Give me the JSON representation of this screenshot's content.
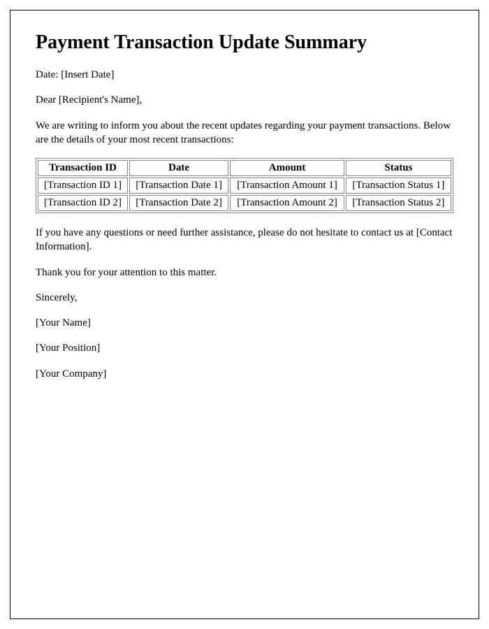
{
  "title": "Payment Transaction Update Summary",
  "date_line": "Date: [Insert Date]",
  "salutation": "Dear [Recipient's Name],",
  "intro": "We are writing to inform you about the recent updates regarding your payment transactions. Below are the details of your most recent transactions:",
  "table": {
    "headers": {
      "id": "Transaction ID",
      "date": "Date",
      "amount": "Amount",
      "status": "Status"
    },
    "rows": [
      {
        "id": "[Transaction ID 1]",
        "date": "[Transaction Date 1]",
        "amount": "[Transaction Amount 1]",
        "status": "[Transaction Status 1]"
      },
      {
        "id": "[Transaction ID 2]",
        "date": "[Transaction Date 2]",
        "amount": "[Transaction Amount 2]",
        "status": "[Transaction Status 2]"
      }
    ]
  },
  "contact": "If you have any questions or need further assistance, please do not hesitate to contact us at [Contact Information].",
  "thanks": "Thank you for your attention to this matter.",
  "closing": "Sincerely,",
  "signature": {
    "name": "[Your Name]",
    "position": "[Your Position]",
    "company": "[Your Company]"
  }
}
